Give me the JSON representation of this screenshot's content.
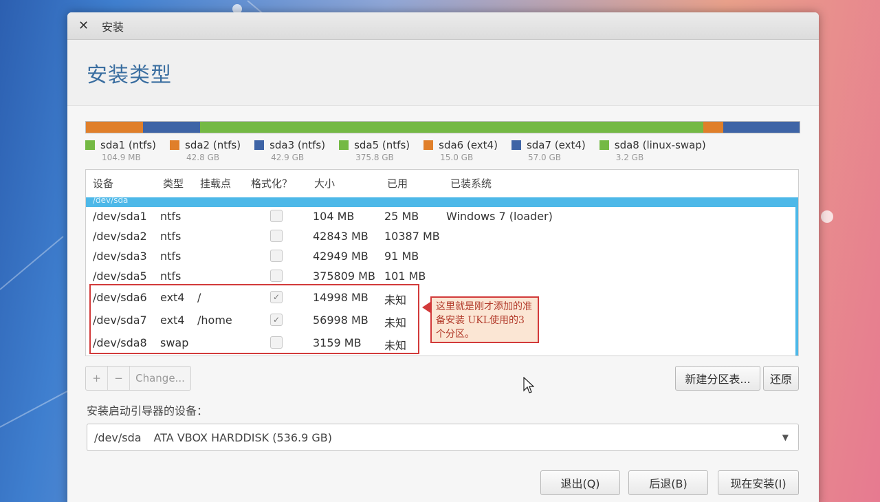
{
  "window": {
    "title": "安装",
    "close_glyph": "✕"
  },
  "header": {
    "title": "安装类型"
  },
  "partitions": [
    {
      "name": "sda1 (ntfs)",
      "size": "104.9 MB",
      "color": "#e07f2a"
    },
    {
      "name": "sda2 (ntfs)",
      "size": "42.8 GB",
      "color": "#e07f2a"
    },
    {
      "name": "sda3 (ntfs)",
      "size": "42.9 GB",
      "color": "#3e64a6"
    },
    {
      "name": "sda5 (ntfs)",
      "size": "375.8 GB",
      "color": "#74b944"
    },
    {
      "name": "sda6 (ext4)",
      "size": "15.0 GB",
      "color": "#e07f2a"
    },
    {
      "name": "sda7 (ext4)",
      "size": "57.0 GB",
      "color": "#3e64a6"
    },
    {
      "name": "sda8 (linux-swap)",
      "size": "3.2 GB",
      "color": "#74b944"
    }
  ],
  "table": {
    "headers": [
      "设备",
      "类型",
      "挂载点",
      "格式化？",
      "大小",
      "已用",
      "已装系统"
    ],
    "selected_row": "/dev/sda",
    "rows": [
      {
        "device": "/dev/sda1",
        "type": "ntfs",
        "mount": "",
        "format": false,
        "size": "104 MB",
        "used": "25 MB",
        "system": "Windows 7 (loader)"
      },
      {
        "device": "/dev/sda2",
        "type": "ntfs",
        "mount": "",
        "format": false,
        "size": "42843 MB",
        "used": "10387 MB",
        "system": ""
      },
      {
        "device": "/dev/sda3",
        "type": "ntfs",
        "mount": "",
        "format": false,
        "size": "42949 MB",
        "used": "91 MB",
        "system": ""
      },
      {
        "device": "/dev/sda5",
        "type": "ntfs",
        "mount": "",
        "format": false,
        "size": "375809 MB",
        "used": "101 MB",
        "system": ""
      },
      {
        "device": "/dev/sda6",
        "type": "ext4",
        "mount": "/",
        "format": true,
        "size": "14998 MB",
        "used": "未知",
        "system": ""
      },
      {
        "device": "/dev/sda7",
        "type": "ext4",
        "mount": "/home",
        "format": true,
        "size": "56998 MB",
        "used": "未知",
        "system": ""
      },
      {
        "device": "/dev/sda8",
        "type": "swap",
        "mount": "",
        "format": false,
        "size": "3159 MB",
        "used": "未知",
        "system": ""
      }
    ]
  },
  "callout": {
    "text": "这里就是刚才添加的准备安装 UKL使用的3个分区。"
  },
  "toolbar": {
    "add": "+",
    "remove": "−",
    "change": "Change..."
  },
  "buttons": {
    "new_table": "新建分区表...",
    "revert": "还原",
    "quit": "退出(Q)",
    "back": "后退(B)",
    "install_now": "现在安装(I)"
  },
  "boot": {
    "label": "安装启动引导器的设备：",
    "device": "/dev/sda",
    "disk": "ATA VBOX HARDDISK (536.9 GB)"
  }
}
